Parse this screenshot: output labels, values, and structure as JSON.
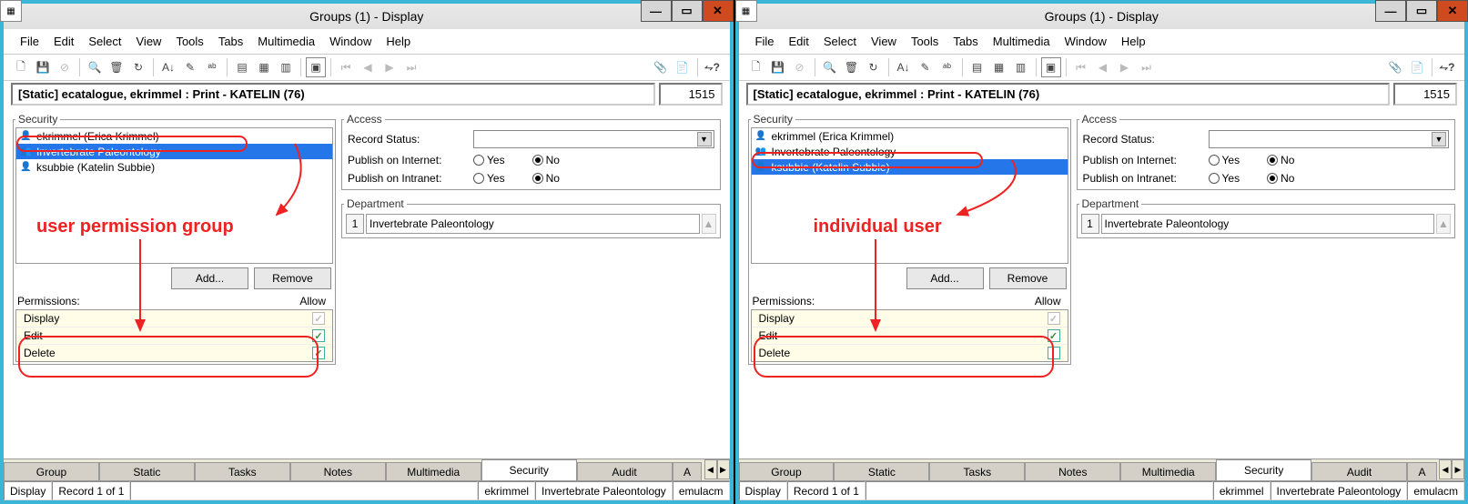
{
  "window": {
    "title": "Groups (1) - Display",
    "path_label": "[Static] ecatalogue, ekrimmel : Print - KATELIN (76)",
    "record_num": "1515"
  },
  "menubar": [
    "File",
    "Edit",
    "Select",
    "View",
    "Tools",
    "Tabs",
    "Multimedia",
    "Window",
    "Help"
  ],
  "security_users": [
    {
      "label": "ekrimmel (Erica Krimmel)",
      "type": "user"
    },
    {
      "label": "Invertebrate Paleontology",
      "type": "group"
    },
    {
      "label": "ksubbie (Katelin Subbie)",
      "type": "user"
    }
  ],
  "buttons": {
    "add": "Add...",
    "remove": "Remove"
  },
  "perm_header": {
    "name": "Permissions:",
    "allow": "Allow"
  },
  "permissions": [
    {
      "name": "Display"
    },
    {
      "name": "Edit"
    },
    {
      "name": "Delete"
    }
  ],
  "access": {
    "groupset": "Access",
    "record_status": "Record Status:",
    "pub_internet": "Publish on Internet:",
    "pub_intranet": "Publish on Intranet:",
    "yes": "Yes",
    "no": "No"
  },
  "department": {
    "legend": "Department",
    "idx": "1",
    "value": "Invertebrate Paleontology"
  },
  "tabs": [
    "Group",
    "Static",
    "Tasks",
    "Notes",
    "Multimedia",
    "Security",
    "Audit",
    "Admin"
  ],
  "status": {
    "mode": "Display",
    "record": "Record 1 of 1",
    "user": "ekrimmel",
    "dept": "Invertebrate Paleontology",
    "host": "emulacm"
  },
  "security_legend": "Security",
  "panel_a": {
    "selected_index": 1,
    "callout": "user permission group",
    "perms": [
      true,
      true,
      true
    ]
  },
  "panel_b": {
    "selected_index": 2,
    "callout": "individual user",
    "perms": [
      true,
      true,
      false
    ]
  }
}
